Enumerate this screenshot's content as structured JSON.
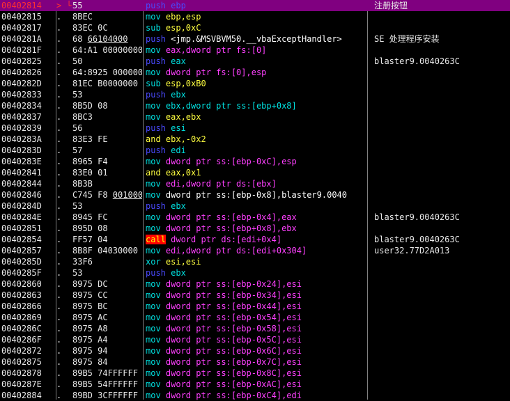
{
  "rows": [
    {
      "addr": "00402814",
      "jump": "> └",
      "hex": "55",
      "hex_u": "",
      "mnem": "push",
      "ops": " ebp",
      "ops_color": "#4a4aff",
      "comment": "注册按钮",
      "selected": true
    },
    {
      "addr": "00402815",
      "jump": ".",
      "hex": "8BEC",
      "hex_u": "",
      "mnem": "mov",
      "ops": " ebp,esp",
      "ops_color": "#ffff40",
      "comment": ""
    },
    {
      "addr": "00402817",
      "jump": ".",
      "hex": "83EC 0C",
      "hex_u": "",
      "mnem": "sub",
      "ops": " esp,0xC",
      "ops_color": "#ffff40",
      "comment": ""
    },
    {
      "addr": "0040281A",
      "jump": ".",
      "hex": "68 ",
      "hex_u": "66104000",
      "mnem": "push",
      "ops": " <jmp.&MSVBVM50.__vbaExceptHandler>",
      "ops_color": "#ffffff",
      "comment": "SE 处理程序安装"
    },
    {
      "addr": "0040281F",
      "jump": ".",
      "hex": "64:A1 00000000",
      "hex_u": "",
      "mnem": "mov",
      "ops": " eax,dword ptr fs:[0]",
      "ops_color": "#ff40ff",
      "comment": ""
    },
    {
      "addr": "00402825",
      "jump": ".",
      "hex": "50",
      "hex_u": "",
      "mnem": "push",
      "ops": " eax",
      "ops_color": "#00e0e0",
      "comment": "blaster9.0040263C"
    },
    {
      "addr": "00402826",
      "jump": ".",
      "hex": "64:8925 00000000",
      "hex_u": "",
      "mnem": "mov",
      "ops": " dword ptr fs:[0],esp",
      "ops_color": "#ff40ff",
      "comment": ""
    },
    {
      "addr": "0040282D",
      "jump": ".",
      "hex": "81EC B0000000",
      "hex_u": "",
      "mnem": "sub",
      "ops": " esp,0xB0",
      "ops_color": "#ffff40",
      "comment": ""
    },
    {
      "addr": "00402833",
      "jump": ".",
      "hex": "53",
      "hex_u": "",
      "mnem": "push",
      "ops": " ebx",
      "ops_color": "#00e0e0",
      "comment": ""
    },
    {
      "addr": "00402834",
      "jump": ".",
      "hex": "8B5D 08",
      "hex_u": "",
      "mnem": "mov",
      "ops": " ebx,dword ptr ss:[ebp+0x8]",
      "ops_color": "#00e0e0",
      "comment": ""
    },
    {
      "addr": "00402837",
      "jump": ".",
      "hex": "8BC3",
      "hex_u": "",
      "mnem": "mov",
      "ops": " eax,ebx",
      "ops_color": "#ffff40",
      "comment": ""
    },
    {
      "addr": "00402839",
      "jump": ".",
      "hex": "56",
      "hex_u": "",
      "mnem": "push",
      "ops": " esi",
      "ops_color": "#00e0e0",
      "comment": ""
    },
    {
      "addr": "0040283A",
      "jump": ".",
      "hex": "83E3 FE",
      "hex_u": "",
      "mnem": "and",
      "ops": " ebx,-0x2",
      "ops_color": "#ffff40",
      "comment": ""
    },
    {
      "addr": "0040283D",
      "jump": ".",
      "hex": "57",
      "hex_u": "",
      "mnem": "push",
      "ops": " edi",
      "ops_color": "#00e0e0",
      "comment": ""
    },
    {
      "addr": "0040283E",
      "jump": ".",
      "hex": "8965 F4",
      "hex_u": "",
      "mnem": "mov",
      "ops": " dword ptr ss:[ebp-0xC],esp",
      "ops_color": "#ff40ff",
      "comment": ""
    },
    {
      "addr": "00402841",
      "jump": ".",
      "hex": "83E0 01",
      "hex_u": "",
      "mnem": "and",
      "ops": " eax,0x1",
      "ops_color": "#ffff40",
      "comment": ""
    },
    {
      "addr": "00402844",
      "jump": ".",
      "hex": "8B3B",
      "hex_u": "",
      "mnem": "mov",
      "ops": " edi,dword ptr ds:[ebx]",
      "ops_color": "#ff40ff",
      "comment": ""
    },
    {
      "addr": "00402846",
      "jump": ".",
      "hex": "C745 F8 ",
      "hex_u": "00100000",
      "mnem": "mov",
      "ops": " dword ptr ss:[ebp-0x8],blaster9.0040",
      "ops_color": "#ffffff",
      "comment": ""
    },
    {
      "addr": "0040284D",
      "jump": ".",
      "hex": "53",
      "hex_u": "",
      "mnem": "push",
      "ops": " ebx",
      "ops_color": "#00e0e0",
      "comment": ""
    },
    {
      "addr": "0040284E",
      "jump": ".",
      "hex": "8945 FC",
      "hex_u": "",
      "mnem": "mov",
      "ops": " dword ptr ss:[ebp-0x4],eax",
      "ops_color": "#ff40ff",
      "comment": "blaster9.0040263C"
    },
    {
      "addr": "00402851",
      "jump": ".",
      "hex": "895D 08",
      "hex_u": "",
      "mnem": "mov",
      "ops": " dword ptr ss:[ebp+0x8],ebx",
      "ops_color": "#ff40ff",
      "comment": ""
    },
    {
      "addr": "00402854",
      "jump": ".",
      "hex": "FF57 04",
      "hex_u": "",
      "mnem": "call",
      "ops": " dword ptr ds:[edi+0x4]",
      "ops_color": "#ff40ff",
      "comment": "blaster9.0040263C"
    },
    {
      "addr": "00402857",
      "jump": ".",
      "hex": "8B8F 04030000",
      "hex_u": "",
      "mnem": "mov",
      "ops": " edi,dword ptr ds:[edi+0x304]",
      "ops_color": "#ff40ff",
      "comment": "user32.77D2A013"
    },
    {
      "addr": "0040285D",
      "jump": ".",
      "hex": "33F6",
      "hex_u": "",
      "mnem": "xor",
      "ops": " esi,esi",
      "ops_color": "#ffff40",
      "comment": ""
    },
    {
      "addr": "0040285F",
      "jump": ".",
      "hex": "53",
      "hex_u": "",
      "mnem": "push",
      "ops": " ebx",
      "ops_color": "#00e0e0",
      "comment": ""
    },
    {
      "addr": "00402860",
      "jump": ".",
      "hex": "8975 DC",
      "hex_u": "",
      "mnem": "mov",
      "ops": " dword ptr ss:[ebp-0x24],esi",
      "ops_color": "#ff40ff",
      "comment": ""
    },
    {
      "addr": "00402863",
      "jump": ".",
      "hex": "8975 CC",
      "hex_u": "",
      "mnem": "mov",
      "ops": " dword ptr ss:[ebp-0x34],esi",
      "ops_color": "#ff40ff",
      "comment": ""
    },
    {
      "addr": "00402866",
      "jump": ".",
      "hex": "8975 BC",
      "hex_u": "",
      "mnem": "mov",
      "ops": " dword ptr ss:[ebp-0x44],esi",
      "ops_color": "#ff40ff",
      "comment": ""
    },
    {
      "addr": "00402869",
      "jump": ".",
      "hex": "8975 AC",
      "hex_u": "",
      "mnem": "mov",
      "ops": " dword ptr ss:[ebp-0x54],esi",
      "ops_color": "#ff40ff",
      "comment": ""
    },
    {
      "addr": "0040286C",
      "jump": ".",
      "hex": "8975 A8",
      "hex_u": "",
      "mnem": "mov",
      "ops": " dword ptr ss:[ebp-0x58],esi",
      "ops_color": "#ff40ff",
      "comment": ""
    },
    {
      "addr": "0040286F",
      "jump": ".",
      "hex": "8975 A4",
      "hex_u": "",
      "mnem": "mov",
      "ops": " dword ptr ss:[ebp-0x5C],esi",
      "ops_color": "#ff40ff",
      "comment": ""
    },
    {
      "addr": "00402872",
      "jump": ".",
      "hex": "8975 94",
      "hex_u": "",
      "mnem": "mov",
      "ops": " dword ptr ss:[ebp-0x6C],esi",
      "ops_color": "#ff40ff",
      "comment": ""
    },
    {
      "addr": "00402875",
      "jump": ".",
      "hex": "8975 84",
      "hex_u": "",
      "mnem": "mov",
      "ops": " dword ptr ss:[ebp-0x7C],esi",
      "ops_color": "#ff40ff",
      "comment": ""
    },
    {
      "addr": "00402878",
      "jump": ".",
      "hex": "89B5 74FFFFFF",
      "hex_u": "",
      "mnem": "mov",
      "ops": " dword ptr ss:[ebp-0x8C],esi",
      "ops_color": "#ff40ff",
      "comment": ""
    },
    {
      "addr": "0040287E",
      "jump": ".",
      "hex": "89B5 54FFFFFF",
      "hex_u": "",
      "mnem": "mov",
      "ops": " dword ptr ss:[ebp-0xAC],esi",
      "ops_color": "#ff40ff",
      "comment": ""
    },
    {
      "addr": "00402884",
      "jump": ".",
      "hex": "89BD 3CFFFFFF",
      "hex_u": "",
      "mnem": "mov",
      "ops": " dword ptr ss:[ebp-0xC4],edi",
      "ops_color": "#ff40ff",
      "comment": ""
    }
  ]
}
